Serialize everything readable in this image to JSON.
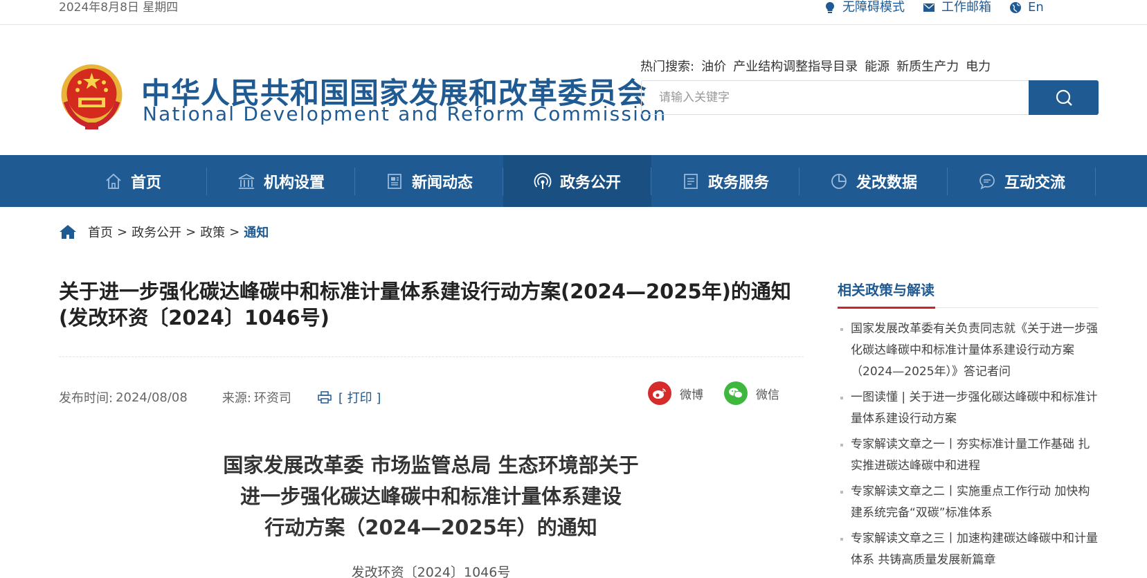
{
  "topbar": {
    "date": "2024年8月8日 星期四",
    "links": [
      {
        "label": "无障碍模式",
        "icon": "accessibility-bulb-icon"
      },
      {
        "label": "工作邮箱",
        "icon": "mail-icon"
      },
      {
        "label": "En",
        "icon": "globe-icon"
      }
    ]
  },
  "header": {
    "emblem": "national-emblem",
    "name_cn": "中华人民共和国国家发展和改革委员会",
    "name_en": "National Development and Reform Commission",
    "hot_search": {
      "label": "热门搜索:",
      "items": [
        "油价",
        "产业结构调整指导目录",
        "能源",
        "新质生产力",
        "电力"
      ]
    },
    "search": {
      "placeholder": "请输入关键字",
      "icon": "search-icon"
    }
  },
  "nav": {
    "items": [
      {
        "label": "首页",
        "icon": "home-icon",
        "active": false
      },
      {
        "label": "机构设置",
        "icon": "institution-icon",
        "active": false
      },
      {
        "label": "新闻动态",
        "icon": "news-icon",
        "active": false
      },
      {
        "label": "政务公开",
        "icon": "broadcast-icon",
        "active": true
      },
      {
        "label": "政务服务",
        "icon": "document-icon",
        "active": false
      },
      {
        "label": "发改数据",
        "icon": "pie-chart-icon",
        "active": false
      },
      {
        "label": "互动交流",
        "icon": "chat-icon",
        "active": false
      }
    ]
  },
  "breadcrumb": {
    "items": [
      "首页",
      "政务公开",
      "政策"
    ],
    "separator": ">",
    "current": "通知"
  },
  "article": {
    "title": "关于进一步强化碳达峰碳中和标准计量体系建设行动方案(2024—2025年)的通知(发改环资〔2024〕1046号)",
    "publish_label": "发布时间:",
    "publish_date": "2024/08/08",
    "source_label": "来源:",
    "source": "环资司",
    "print_label": "[ 打印 ]",
    "share": [
      {
        "label": "微博",
        "icon": "weibo-icon",
        "color": "#d52b2b"
      },
      {
        "label": "微信",
        "icon": "wechat-icon",
        "color": "#3fb73f"
      }
    ],
    "doc_heading_lines": [
      "国家发展改革委 市场监管总局 生态环境部关于",
      "进一步强化碳达峰碳中和标准计量体系建设",
      "行动方案（2024—2025年）的通知"
    ],
    "doc_number": "发改环资〔2024〕1046号"
  },
  "sidebar": {
    "heading": "相关政策与解读",
    "items": [
      "国家发展改革委有关负责同志就《关于进一步强化碳达峰碳中和标准计量体系建设行动方案（2024—2025年）》答记者问",
      "一图读懂 | 关于进一步强化碳达峰碳中和标准计量体系建设行动方案",
      "专家解读文章之一丨夯实标准计量工作基础 扎实推进碳达峰碳中和进程",
      "专家解读文章之二丨实施重点工作行动 加快构建系统完备“双碳”标准体系",
      "专家解读文章之三丨加速构建碳达峰碳中和计量体系 共铸高质量发展新篇章"
    ]
  },
  "colors": {
    "brand": "#1f5a92",
    "accent_red": "#c9252b"
  }
}
